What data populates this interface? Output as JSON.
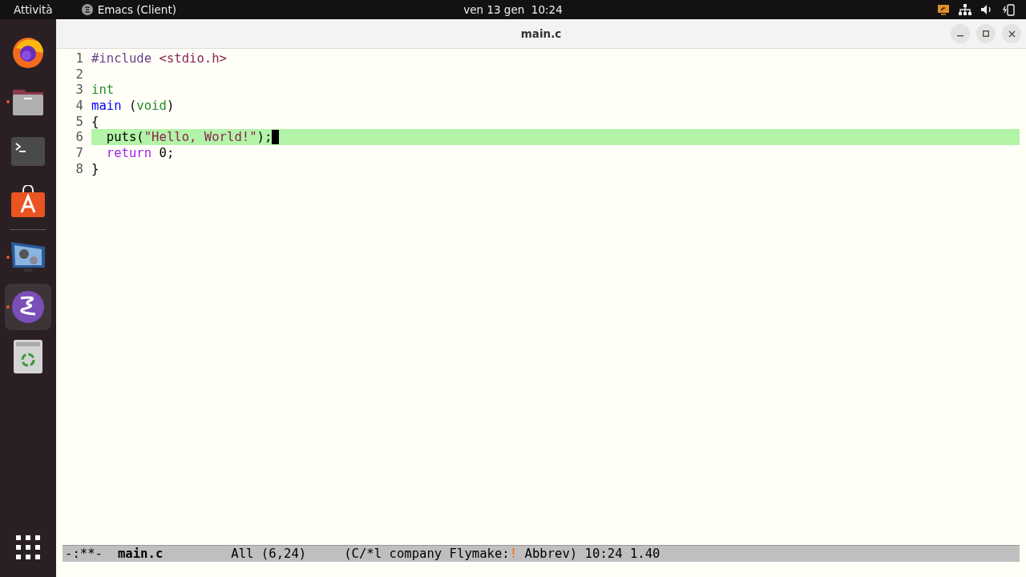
{
  "top_bar": {
    "activities": "Attività",
    "app_name": "Emacs (Client)",
    "clock": "ven 13 gen  10:24"
  },
  "dock": [
    {
      "kind": "firefox",
      "running": false,
      "selected": false
    },
    {
      "kind": "files",
      "running": true,
      "selected": false
    },
    {
      "kind": "terminal",
      "running": false,
      "selected": false
    },
    {
      "kind": "store",
      "running": false,
      "selected": false
    },
    {
      "kind": "separator"
    },
    {
      "kind": "media",
      "running": true,
      "selected": false
    },
    {
      "kind": "emacs",
      "running": true,
      "selected": true
    },
    {
      "kind": "trash",
      "running": false,
      "selected": false
    }
  ],
  "window": {
    "title": "main.c"
  },
  "editor": {
    "lines": [
      {
        "number": "1",
        "current": false,
        "tokens": [
          {
            "kind": "preprocessor",
            "text": "#include"
          },
          {
            "kind": "string",
            "text": " <stdio.h>"
          }
        ]
      },
      {
        "number": "2",
        "current": false
      },
      {
        "number": "3",
        "current": false,
        "tokens": [
          {
            "kind": "type",
            "text": "int"
          }
        ]
      },
      {
        "number": "4",
        "current": false,
        "tokens": [
          {
            "kind": "function",
            "text": "main"
          },
          {
            "kind": "plain",
            "text": " ("
          },
          {
            "kind": "type",
            "text": "void"
          },
          {
            "kind": "plain",
            "text": ")"
          }
        ]
      },
      {
        "number": "5",
        "current": false,
        "tokens": [
          {
            "kind": "plain",
            "text": "{"
          }
        ]
      },
      {
        "number": "6",
        "current": true,
        "tokens": [
          {
            "kind": "plain",
            "text": "  puts("
          },
          {
            "kind": "string",
            "text": "\"Hello, World!\""
          },
          {
            "kind": "plain",
            "text": ");"
          }
        ]
      },
      {
        "number": "7",
        "current": false,
        "tokens": [
          {
            "kind": "keyword",
            "text": "  return"
          },
          {
            "kind": "plain",
            "text": " 0;"
          }
        ]
      },
      {
        "number": "8",
        "current": false,
        "tokens": [
          {
            "kind": "plain",
            "text": "}"
          }
        ]
      }
    ]
  },
  "mode_line": {
    "status": "-:**-",
    "buffer": "main.c",
    "position": "All (6,24)",
    "modes_before": "(C/*l company Flymake:",
    "flag": "!",
    "modes_after": " Abbrev) 10:24 1.40"
  }
}
